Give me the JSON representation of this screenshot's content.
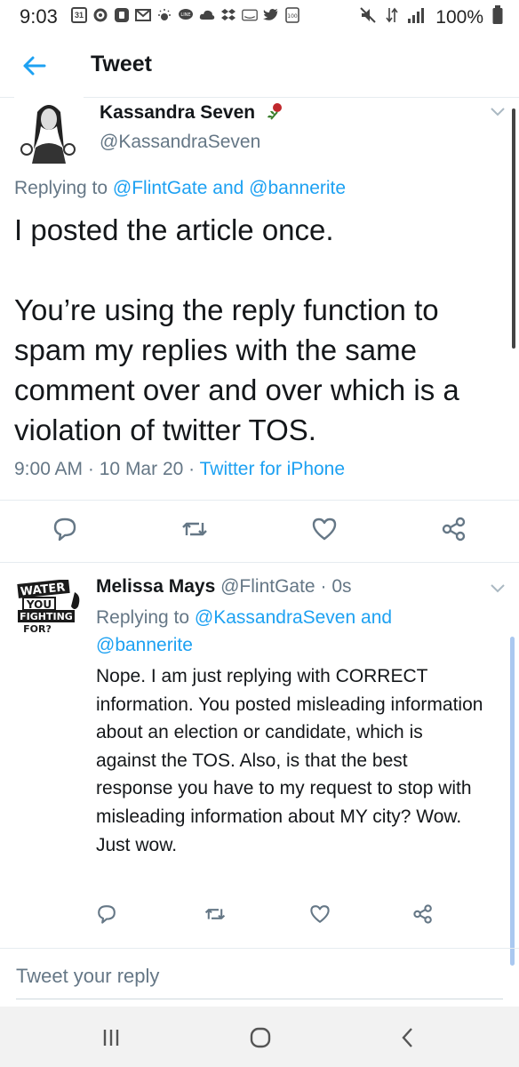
{
  "status_bar": {
    "time": "9:03",
    "calendar_day": "31",
    "battery": "100%"
  },
  "header": {
    "title": "Tweet"
  },
  "main_tweet": {
    "author_name": "Kassandra Seven",
    "author_handle": "@KassandraSeven",
    "replying_prefix": "Replying to",
    "replying_user1": "@FlintGate",
    "replying_and": "and",
    "replying_user2": "@bannerite",
    "text": "I posted the article once.\n\nYou’re using the reply function to spam my replies with the same comment over and over which is a violation of twitter TOS.",
    "time": "9:00 AM",
    "date": "10 Mar 20",
    "separator": "·",
    "source": "Twitter for iPhone"
  },
  "reply_tweet": {
    "author_name": "Melissa Mays",
    "author_handle": "@FlintGate",
    "age": "0s",
    "separator": "·",
    "replying_prefix": "Replying to",
    "replying_user1": "@KassandraSeven",
    "replying_and": "and",
    "replying_user2": "@bannerite",
    "text": "Nope. I am just replying with CORRECT information. You posted misleading information about an election or candidate, which is against the TOS. Also, is that the best response you have to my request to stop with misleading information about MY city? Wow. Just wow.",
    "avatar_text": [
      "WATER",
      "YOU",
      "FIGHTING",
      "FOR?"
    ]
  },
  "compose": {
    "placeholder": "Tweet your reply"
  },
  "colors": {
    "accent": "#1da1f2",
    "secondary_text": "#657786",
    "primary_text": "#14171a",
    "divider": "#e6ecf0"
  },
  "icons": {
    "back": "arrow-left-icon",
    "reply": "comment-icon",
    "retweet": "retweet-icon",
    "like": "heart-icon",
    "share": "share-icon",
    "caret": "chevron-down-icon"
  }
}
